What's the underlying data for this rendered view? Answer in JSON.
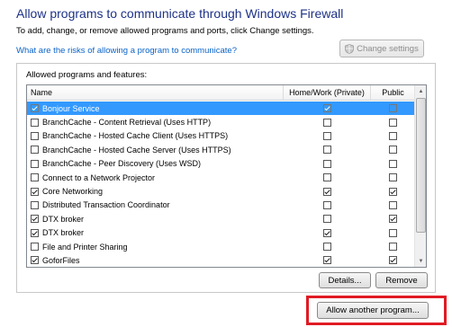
{
  "header": {
    "title": "Allow programs to communicate through Windows Firewall",
    "subtitle": "To add, change, or remove allowed programs and ports, click Change settings.",
    "risk_link": "What are the risks of allowing a program to communicate?",
    "change_settings_label": "Change settings"
  },
  "group": {
    "label": "Allowed programs and features:",
    "columns": [
      "Name",
      "Home/Work (Private)",
      "Public"
    ],
    "rows": [
      {
        "name": "Bonjour Service",
        "enabled": true,
        "private": true,
        "public": false,
        "selected": true
      },
      {
        "name": "BranchCache - Content Retrieval (Uses HTTP)",
        "enabled": false,
        "private": false,
        "public": false
      },
      {
        "name": "BranchCache - Hosted Cache Client (Uses HTTPS)",
        "enabled": false,
        "private": false,
        "public": false
      },
      {
        "name": "BranchCache - Hosted Cache Server (Uses HTTPS)",
        "enabled": false,
        "private": false,
        "public": false
      },
      {
        "name": "BranchCache - Peer Discovery (Uses WSD)",
        "enabled": false,
        "private": false,
        "public": false
      },
      {
        "name": "Connect to a Network Projector",
        "enabled": false,
        "private": false,
        "public": false
      },
      {
        "name": "Core Networking",
        "enabled": true,
        "private": true,
        "public": true
      },
      {
        "name": "Distributed Transaction Coordinator",
        "enabled": false,
        "private": false,
        "public": false
      },
      {
        "name": "DTX broker",
        "enabled": true,
        "private": false,
        "public": true
      },
      {
        "name": "DTX broker",
        "enabled": true,
        "private": true,
        "public": false
      },
      {
        "name": "File and Printer Sharing",
        "enabled": false,
        "private": false,
        "public": false
      },
      {
        "name": "GoforFiles",
        "enabled": true,
        "private": true,
        "public": true
      }
    ]
  },
  "buttons": {
    "details": "Details...",
    "remove": "Remove",
    "allow_another": "Allow another program..."
  },
  "colors": {
    "title": "#1e3287",
    "link": "#0b63c7",
    "selection": "#3399ff",
    "highlight": "#e01b24"
  },
  "icons": {
    "change_settings": "shield-icon",
    "scroll_up": "arrow-up-icon",
    "scroll_down": "arrow-down-icon"
  }
}
